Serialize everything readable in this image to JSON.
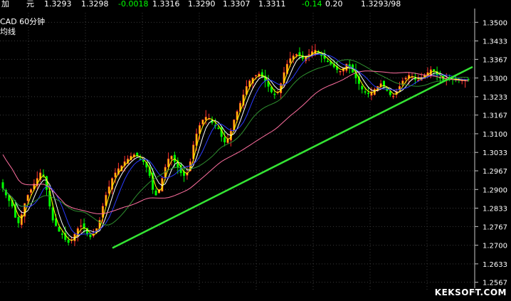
{
  "quote": {
    "name": "加",
    "unit": "元",
    "bid": "1.3293",
    "ask": "1.3298",
    "change": "-0.0018",
    "open": "1.3316",
    "low": "1.3290",
    "prev": "1.3307",
    "high": "1.3311",
    "pct": "-0.14",
    "range": "0.20",
    "last": "1.3293/98"
  },
  "chart": {
    "title": "CAD   60分钟",
    "subtitle": "均线"
  },
  "watermark": "KEKSOFT.COM",
  "colors": {
    "background": "#000000",
    "axis_text": "#ffffff",
    "grid": "#3a3a3a",
    "bull_candle": "#ff3030",
    "bear_candle": "#00ff00",
    "ma_short": "#ffffff",
    "ma_mid": "#ffff00",
    "ma_long": "#2a3bff",
    "ma_slow": "#2f8f2f",
    "ma_200": "#ff6fa0",
    "trend_line": "#34e534",
    "quote_green": "#00ff00",
    "quote_white": "#ffffff"
  },
  "chart_data": {
    "type": "line",
    "title": "",
    "y_ticks": [
      "1.3500",
      "1.3433",
      "1.3367",
      "1.3300",
      "1.3233",
      "1.3167",
      "1.3100",
      "1.3033",
      "1.2967",
      "1.2900",
      "1.2833",
      "1.2767",
      "1.2700",
      "1.2633",
      "1.2567"
    ],
    "ylim": [
      1.2533,
      1.3534
    ],
    "x_count": 150,
    "series": [
      {
        "key": "close",
        "values": [
          1.2905,
          1.288,
          1.286,
          1.284,
          1.28,
          1.278,
          1.281,
          1.285,
          1.288,
          1.29,
          1.292,
          1.294,
          1.296,
          1.295,
          1.29,
          1.284,
          1.279,
          1.277,
          1.275,
          1.274,
          1.272,
          1.271,
          1.272,
          1.274,
          1.276,
          1.277,
          1.276,
          1.274,
          1.273,
          1.274,
          1.276,
          1.279,
          1.284,
          1.288,
          1.291,
          1.294,
          1.296,
          1.2975,
          1.2985,
          1.3,
          1.301,
          1.302,
          1.3025,
          1.302,
          1.301,
          1.3,
          1.298,
          1.295,
          1.29,
          1.288,
          1.29,
          1.294,
          1.298,
          1.301,
          1.302,
          1.3,
          1.298,
          1.296,
          1.295,
          1.296,
          1.3,
          1.306,
          1.31,
          1.313,
          1.315,
          1.316,
          1.3155,
          1.314,
          1.313,
          1.312,
          1.309,
          1.307,
          1.308,
          1.311,
          1.315,
          1.318,
          1.321,
          1.324,
          1.327,
          1.329,
          1.33,
          1.331,
          1.3315,
          1.3305,
          1.329,
          1.327,
          1.325,
          1.324,
          1.325,
          1.328,
          1.332,
          1.335,
          1.337,
          1.338,
          1.3385,
          1.338,
          1.337,
          1.3375,
          1.3385,
          1.3395,
          1.34,
          1.339,
          1.338,
          1.337,
          1.336,
          1.335,
          1.334,
          1.333,
          1.3325,
          1.3335,
          1.335,
          1.334,
          1.332,
          1.33,
          1.328,
          1.326,
          1.325,
          1.3245,
          1.325,
          1.326,
          1.327,
          1.328,
          1.327,
          1.3255,
          1.324,
          1.3235,
          1.325,
          1.327,
          1.329,
          1.33,
          1.331,
          1.3305,
          1.3295,
          1.3293,
          1.33,
          1.331,
          1.332,
          1.333,
          1.3325,
          1.331,
          1.33,
          1.3293,
          1.3295,
          1.3298,
          1.3296,
          1.3294,
          1.3293,
          1.3295,
          1.3293,
          1.3293
        ]
      }
    ]
  }
}
